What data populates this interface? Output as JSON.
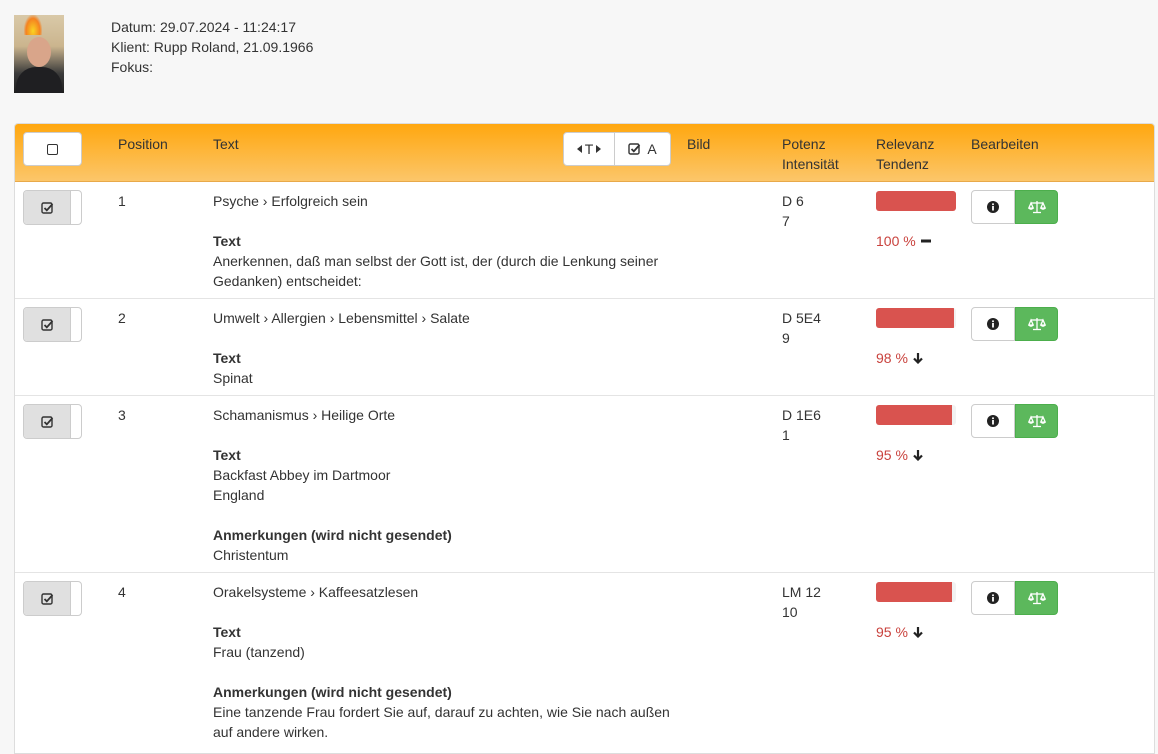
{
  "header": {
    "datum": "Datum: 29.07.2024 - 11:24:17",
    "klient": "Klient: Rupp Roland, 21.09.1966",
    "fokus": "Fokus:"
  },
  "table": {
    "columns": {
      "position": "Position",
      "text": "Text",
      "bild": "Bild",
      "potenz": "Potenz",
      "intensitaet": "Intensität",
      "relevanz": "Relevanz",
      "tendenz": "Tendenz",
      "bearbeiten": "Bearbeiten"
    },
    "toggle_t_label": "T",
    "toggle_a_label": "A"
  },
  "rows": [
    {
      "position": "1",
      "path": "Psyche › Erfolgreich sein",
      "text_label": "Text",
      "text_lines": [
        "Anerkennen, daß man selbst der Gott ist, der (durch die Lenkung seiner",
        "Gedanken) entscheidet:"
      ],
      "potenz": "D 6",
      "intensitaet": "7",
      "relevanz_value": 100,
      "relevanz_text": "100 %",
      "tendenz": "minus"
    },
    {
      "position": "2",
      "path": "Umwelt › Allergien › Lebensmittel › Salate",
      "text_label": "Text",
      "text_lines": [
        "Spinat"
      ],
      "potenz": "D 5E4",
      "intensitaet": "9",
      "relevanz_value": 98,
      "relevanz_text": "98 %",
      "tendenz": "arrow-down"
    },
    {
      "position": "3",
      "path": "Schamanismus › Heilige Orte",
      "text_label": "Text",
      "text_lines": [
        "Backfast Abbey im Dartmoor",
        "England"
      ],
      "note_label": "Anmerkungen (wird nicht gesendet)",
      "note_lines": [
        "Christentum"
      ],
      "potenz": "D 1E6",
      "intensitaet": "1",
      "relevanz_value": 95,
      "relevanz_text": "95 %",
      "tendenz": "arrow-down"
    },
    {
      "position": "4",
      "path": "Orakelsysteme › Kaffeesatzlesen",
      "text_label": "Text",
      "text_lines": [
        "Frau (tanzend)"
      ],
      "note_label": "Anmerkungen (wird nicht gesendet)",
      "note_lines": [
        "Eine tanzende Frau fordert Sie auf, darauf zu achten, wie Sie nach außen",
        "auf andere wirken."
      ],
      "potenz": "LM 12",
      "intensitaet": "10",
      "relevanz_value": 95,
      "relevanz_text": "95 %",
      "tendenz": "arrow-down"
    }
  ],
  "colors": {
    "header_orange": "#ffa70f",
    "bar_red": "#d9534f",
    "button_green": "#5cb85c"
  }
}
